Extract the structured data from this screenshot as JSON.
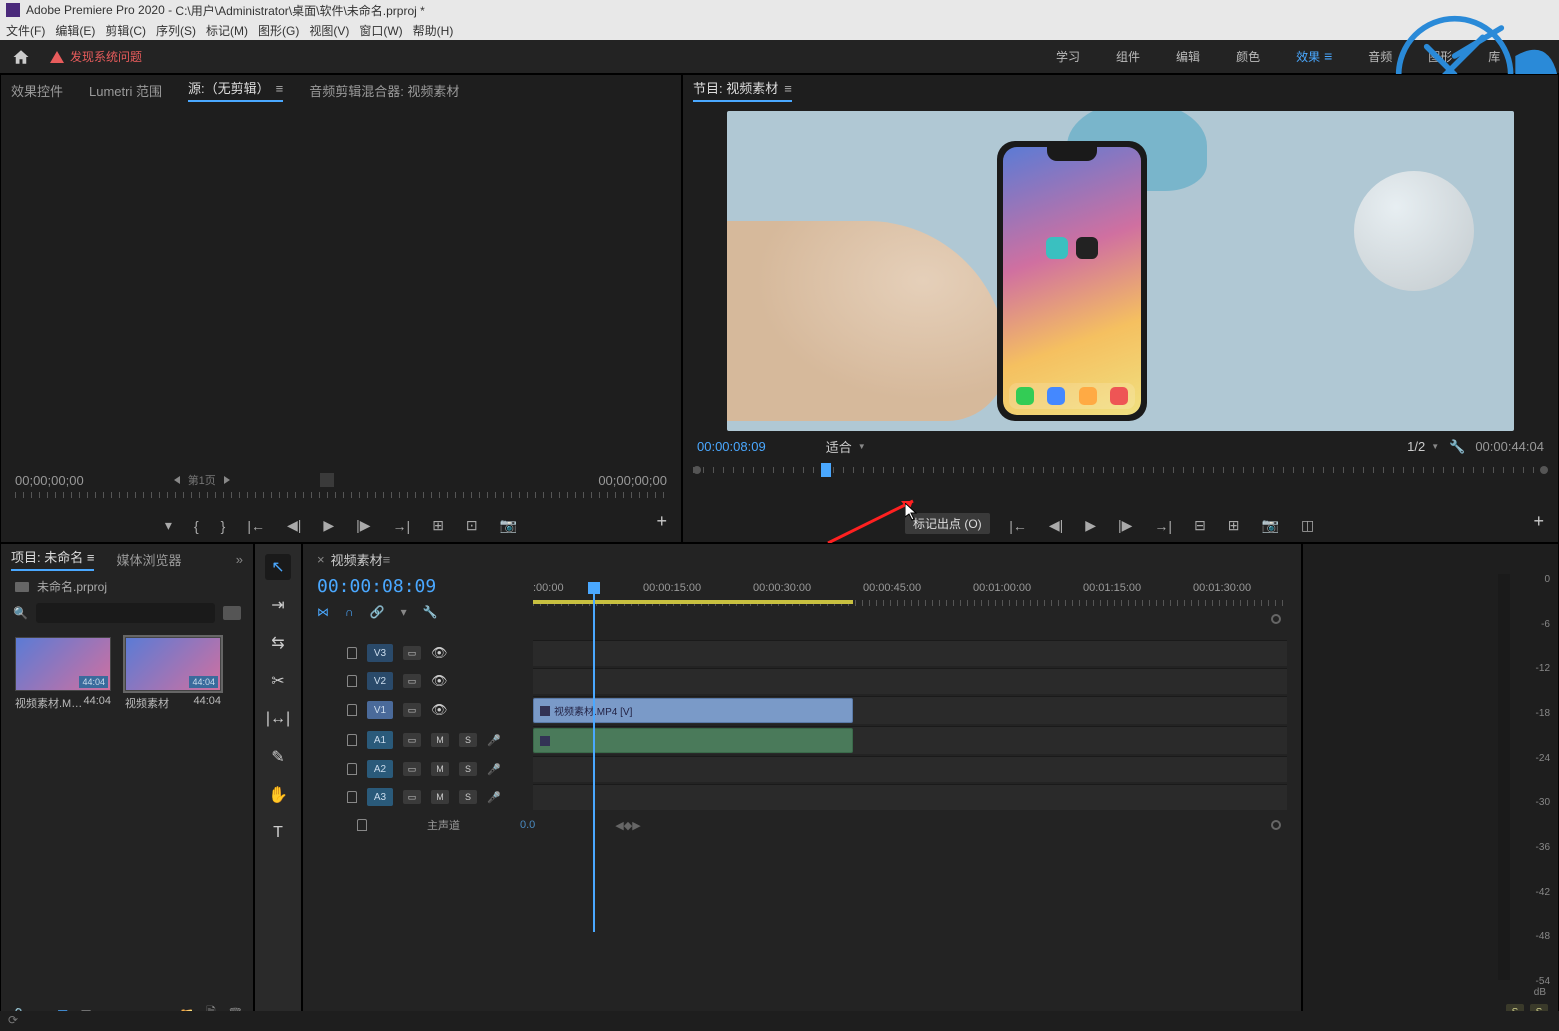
{
  "titlebar": {
    "app": "Adobe Premiere Pro 2020",
    "path": "C:\\用户\\Administrator\\桌面\\软件\\未命名.prproj *"
  },
  "menu": [
    "文件(F)",
    "编辑(E)",
    "剪辑(C)",
    "序列(S)",
    "标记(M)",
    "图形(G)",
    "视图(V)",
    "窗口(W)",
    "帮助(H)"
  ],
  "warning": "发现系统问题",
  "workspaces": [
    "学习",
    "组件",
    "编辑",
    "颜色",
    "效果",
    "音频",
    "图形",
    "库"
  ],
  "workspace_active": 4,
  "source": {
    "tabs": [
      "效果控件",
      "Lumetri 范围",
      "源:（无剪辑）",
      "音频剪辑混合器: 视频素材"
    ],
    "active_tab": 2,
    "tc_left": "00;00;00;00",
    "tc_right": "00;00;00;00",
    "pager": "第1页"
  },
  "program": {
    "tab": "节目: 视频素材",
    "tc_left": "00:00:08:09",
    "fit": "适合",
    "zoom": "1/2",
    "tc_right": "00:00:44:04"
  },
  "tooltip": "标记出点 (O)",
  "project": {
    "tabs": [
      "项目: 未命名",
      "媒体浏览器"
    ],
    "active_tab": 0,
    "file": "未命名.prproj",
    "items": [
      {
        "name": "视频素材.M…",
        "dur": "44:04"
      },
      {
        "name": "视频素材",
        "dur": "44:04"
      }
    ]
  },
  "tools": [
    "select",
    "track-select",
    "ripple",
    "razor",
    "slip",
    "pen",
    "hand",
    "type"
  ],
  "timeline": {
    "tab": "视频素材",
    "tc": "00:00:08:09",
    "ruler": [
      ":00:00",
      "00:00:15:00",
      "00:00:30:00",
      "00:00:45:00",
      "00:01:00:00",
      "00:01:15:00",
      "00:01:30:00"
    ],
    "vtracks": [
      "V3",
      "V2",
      "V1"
    ],
    "atracks": [
      "A1",
      "A2",
      "A3"
    ],
    "clip_v": "视频素材.MP4 [V]",
    "master": "主声道",
    "master_val": "0.0",
    "mute": "M",
    "solo": "S"
  },
  "meter": {
    "ticks": [
      "0",
      "-6",
      "-12",
      "-18",
      "-24",
      "-30",
      "-36",
      "-42",
      "-48",
      "-54"
    ],
    "db": "dB",
    "s": "S"
  }
}
